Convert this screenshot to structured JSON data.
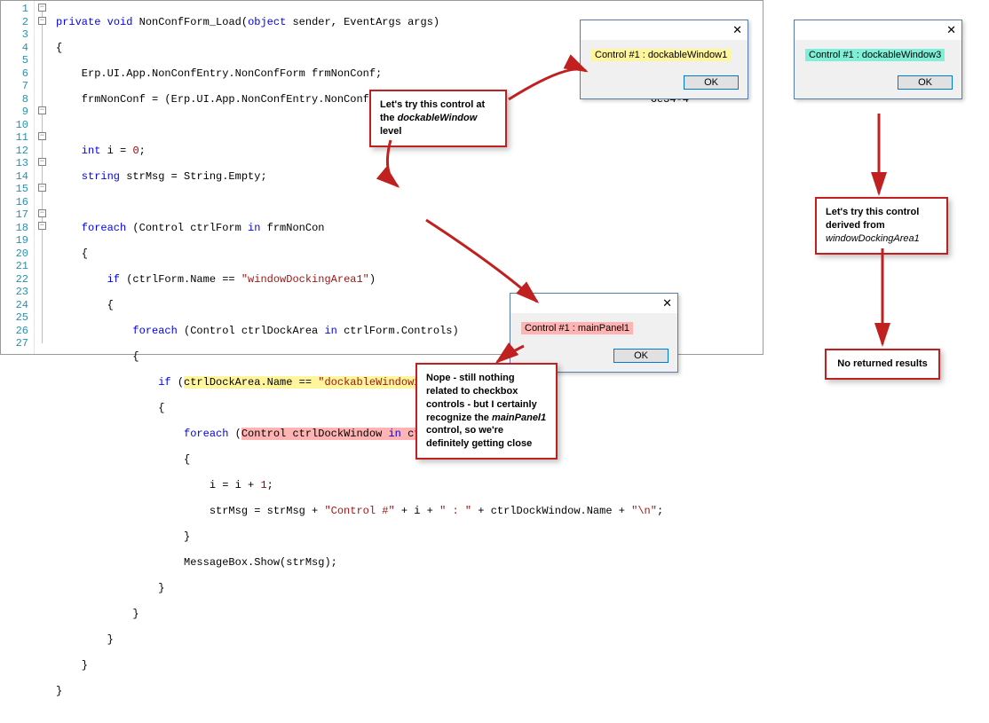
{
  "gutter": [
    "1",
    "2",
    "3",
    "4",
    "5",
    "6",
    "7",
    "8",
    "9",
    "10",
    "11",
    "12",
    "13",
    "14",
    "15",
    "16",
    "17",
    "18",
    "19",
    "20",
    "21",
    "22",
    "23",
    "24",
    "25",
    "26",
    "27"
  ],
  "code": {
    "l1_kw1": "private",
    "l1_kw2": "void",
    "l1_name": " NonConfForm_Load(",
    "l1_kw3": "object",
    "l1_mid": " sender, EventArgs args)",
    "l2": "{",
    "l3": "    Erp.UI.App.NonConfEntry.NonConfForm frmNonConf;",
    "l4a": "    frmNonConf = (Erp.UI.App.NonConfEntry.NonConfForm)csm.GetNativeCo                        6e34-4",
    "l6_kw": "    int",
    "l6_rest": " i = ",
    "l6_num": "0",
    "l6_semi": ";",
    "l7_kw": "    string",
    "l7_rest": " strMsg = String.Empty;",
    "l9_kw": "    foreach",
    "l9_rest": " (Control ctrlForm ",
    "l9_in": "in",
    "l9_rest2": " frmNonCon",
    "l10": "    {",
    "l11_kw": "        if",
    "l11_rest": " (ctrlForm.Name == ",
    "l11_str": "\"windowDockingArea1\"",
    "l11_close": ")",
    "l12": "        {",
    "l13_kw": "            foreach",
    "l13_rest": " (Control ctrlDockArea ",
    "l13_in": "in",
    "l13_rest2": " ctrlForm.Controls)",
    "l14": "            {",
    "l15_kw": "                if",
    "l15_rest1": " (",
    "l15_hl": "ctrlDockArea.Name == ",
    "l15_str": "\"dockableWindow1\"",
    "l15_close": ")",
    "l16": "                {",
    "l17_kw": "                    foreach",
    "l17_rest1": " (",
    "l17_hl": "Control ctrlDockWindow ",
    "l17_in": "in",
    "l17_hl2": " ctrlDockArea.Controls",
    "l17_close": ")",
    "l18": "                    {",
    "l19a": "                        i = i + ",
    "l19_num": "1",
    "l19b": ";",
    "l20a": "                        strMsg = strMsg + ",
    "l20_s1": "\"Control #\"",
    "l20b": " + i + ",
    "l20_s2": "\" : \"",
    "l20c": " + ctrlDockWindow.Name + ",
    "l20_s3": "\"\\n\"",
    "l20d": ";",
    "l21": "                    }",
    "l22": "                    MessageBox.Show(strMsg);",
    "l23": "                }",
    "l24": "            }",
    "l25": "        }",
    "l26": "    }",
    "l27": "}"
  },
  "dialog1": {
    "msg": "Control #1 : dockableWindow1",
    "ok": "OK",
    "hl": "yellow"
  },
  "dialog2": {
    "msg": "Control #1 : dockableWindow3",
    "ok": "OK",
    "hl": "cyan"
  },
  "dialog3": {
    "msg": "Control #1 : mainPanel1",
    "ok": "OK",
    "hl": "pink"
  },
  "callout1": {
    "t1": "Let's try this control at the ",
    "i1": "dockableWindow",
    "t2": " level"
  },
  "callout2": {
    "t1": "Nope - still nothing related to checkbox controls - but I certainly recognize the ",
    "i1": "mainPanel1",
    "t2": " control, so we're definitely getting close"
  },
  "callout3": {
    "t1": "Let's try this control derived from ",
    "i1": "windowDockingArea1"
  },
  "callout4": {
    "t1": "No returned results"
  }
}
